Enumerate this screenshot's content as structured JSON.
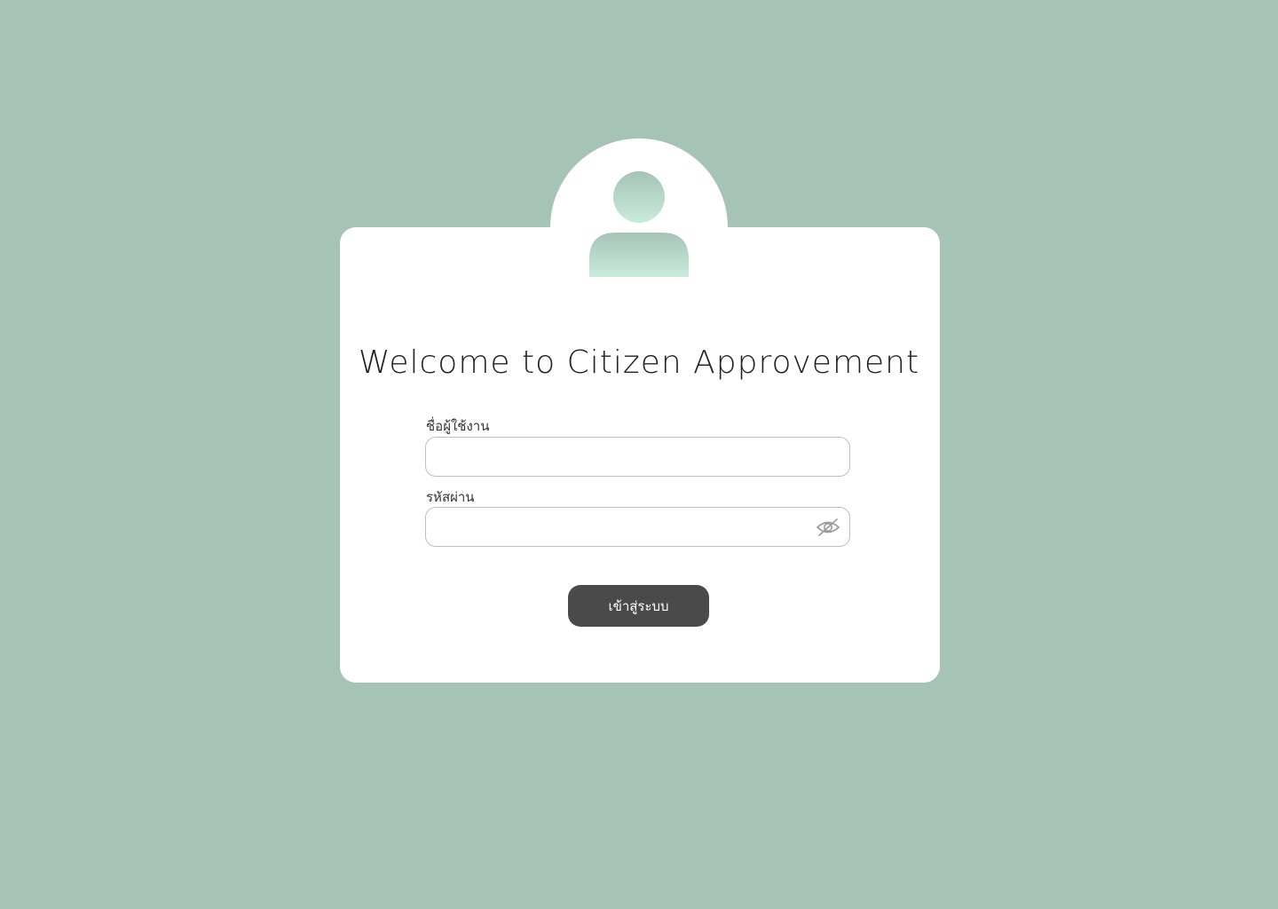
{
  "theme": {
    "background": "#a6c4b5",
    "card": "#ffffff",
    "button": "#4a4a4a",
    "avatar_gradient_top": "#a6c4b5",
    "avatar_gradient_bottom": "#c9ebdc"
  },
  "avatar": {
    "icon": "user-icon"
  },
  "welcome": {
    "title": "Welcome to Citizen Approvement"
  },
  "form": {
    "username_label": "ชื่อผู้ใช้งาน",
    "username_value": "",
    "password_label": "รหัสผ่าน",
    "password_value": "",
    "password_toggle_icon": "eye-slash-icon",
    "submit_label": "เข้าสู่ระบบ"
  }
}
